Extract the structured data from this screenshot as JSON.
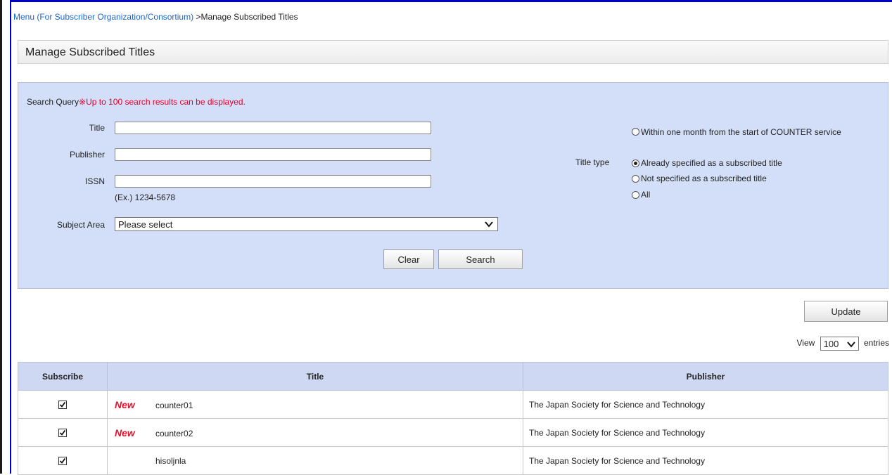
{
  "breadcrumb": {
    "parent": "Menu (For Subscriber Organization/Consortium)",
    "separator": " >",
    "current": "Manage Subscribed Titles"
  },
  "page_title": "Manage Subscribed Titles",
  "search": {
    "query_label": "Search Query",
    "query_note": "※Up to 100 search results can be displayed.",
    "title_label": "Title",
    "title_value": "",
    "publisher_label": "Publisher",
    "publisher_value": "",
    "issn_label": "ISSN",
    "issn_value": "",
    "issn_hint": "(Ex.) 1234-5678",
    "subject_label": "Subject Area",
    "subject_value": "Please select",
    "title_type_label": "Title type",
    "title_type_options": [
      {
        "label": "Within one month from the start of COUNTER service",
        "selected": false
      },
      {
        "label": "Already specified as a subscribed title",
        "selected": true
      },
      {
        "label": "Not specified as a subscribed title",
        "selected": false
      },
      {
        "label": "All",
        "selected": false
      }
    ],
    "clear_label": "Clear",
    "search_label": "Search"
  },
  "update_label": "Update",
  "view": {
    "prefix": "View",
    "value": "100",
    "suffix": "entries"
  },
  "table": {
    "headers": [
      "Subscribe",
      "Title",
      "Publisher"
    ],
    "new_badge": "New",
    "rows": [
      {
        "checked": true,
        "is_new": true,
        "title": "counter01",
        "publisher": "The Japan Society for Science and Technology"
      },
      {
        "checked": true,
        "is_new": true,
        "title": "counter02",
        "publisher": "The Japan Society for Science and Technology"
      },
      {
        "checked": true,
        "is_new": false,
        "title": "hisoljnla",
        "publisher": "The Japan Society for Science and Technology"
      }
    ]
  },
  "colors": {
    "link": "#1a66cc",
    "note": "#e8002a",
    "panel": "#d3dff9",
    "header": "#ced8f2",
    "frame": "#0000cc"
  }
}
